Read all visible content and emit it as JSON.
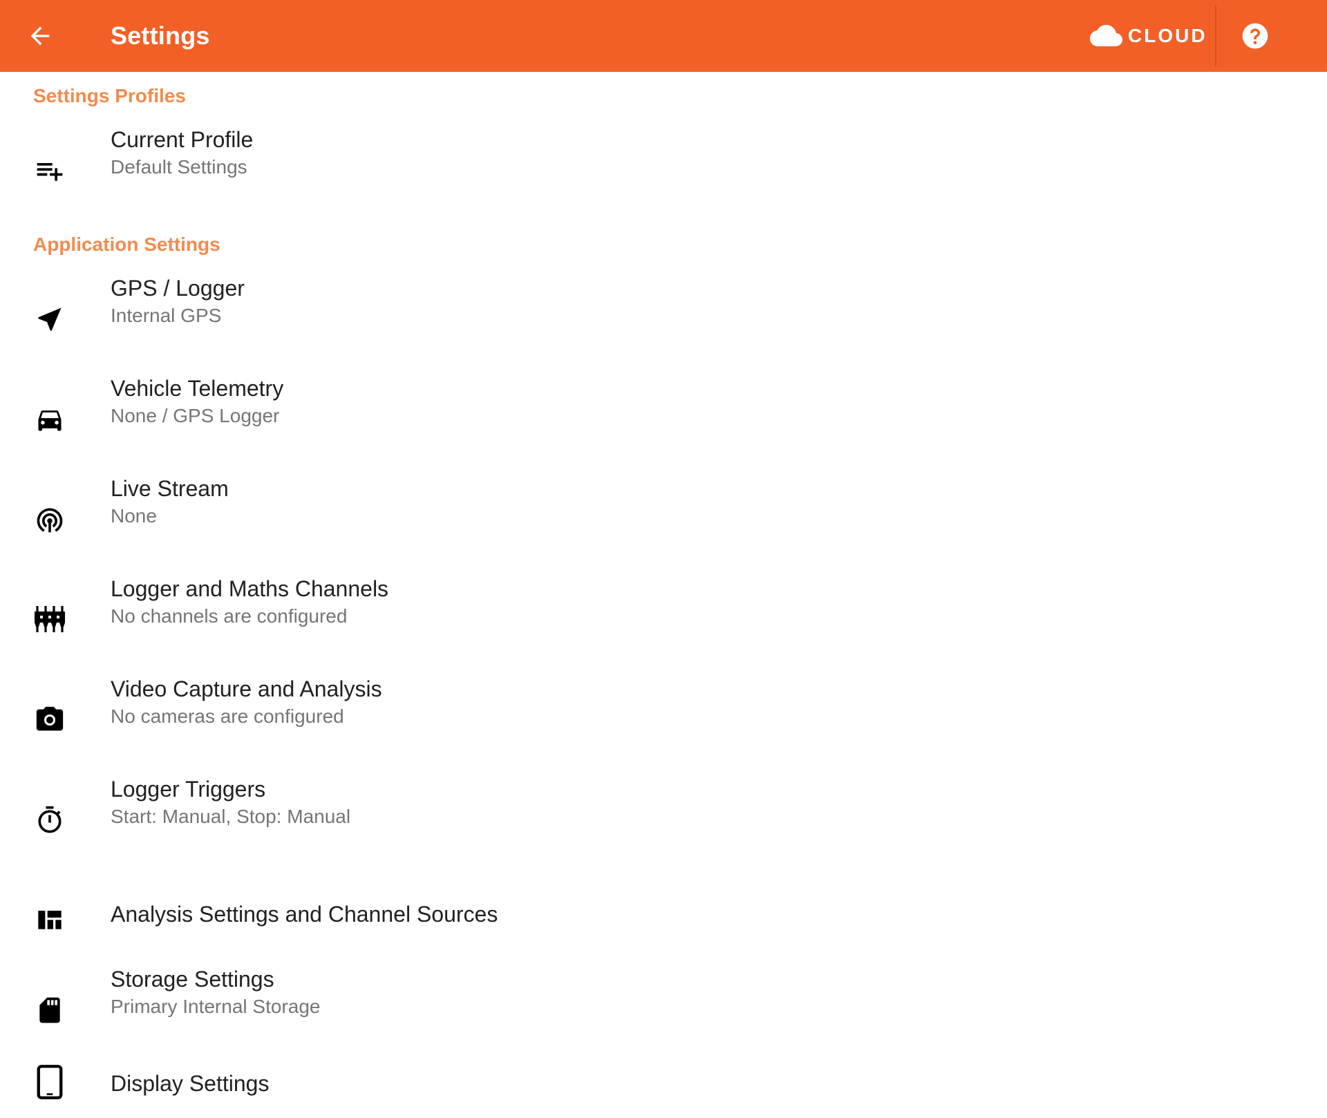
{
  "appbar": {
    "title": "Settings",
    "back_icon": "arrow-back-icon",
    "cloud_label": "CLOUD",
    "cloud_icon": "cloud-icon",
    "help_icon": "help-circle-icon",
    "color": "#F26027"
  },
  "sections": {
    "profiles_title": "Settings Profiles",
    "application_title": "Application Settings",
    "accent_color": "#F28B4E"
  },
  "items": [
    {
      "icon": "playlist-add-icon",
      "title": "Current Profile",
      "subtitle": "Default Settings"
    },
    {
      "icon": "navigation-arrow-icon",
      "title": "GPS / Logger",
      "subtitle": "Internal GPS"
    },
    {
      "icon": "car-icon",
      "title": "Vehicle Telemetry",
      "subtitle": "None / GPS Logger"
    },
    {
      "icon": "broadcast-antenna-icon",
      "title": "Live Stream",
      "subtitle": "None"
    },
    {
      "icon": "input-channels-icon",
      "title": "Logger and Maths Channels",
      "subtitle": "No channels are configured"
    },
    {
      "icon": "camera-icon",
      "title": "Video Capture and Analysis",
      "subtitle": "No cameras are configured"
    },
    {
      "icon": "timer-icon",
      "title": "Logger Triggers",
      "subtitle": "Start: Manual, Stop: Manual"
    },
    {
      "icon": "dashboard-icon",
      "title": "Analysis Settings and Channel Sources",
      "subtitle": ""
    },
    {
      "icon": "sd-card-icon",
      "title": "Storage Settings",
      "subtitle": "Primary Internal Storage"
    },
    {
      "icon": "tablet-icon",
      "title": "Display Settings",
      "subtitle": ""
    }
  ]
}
